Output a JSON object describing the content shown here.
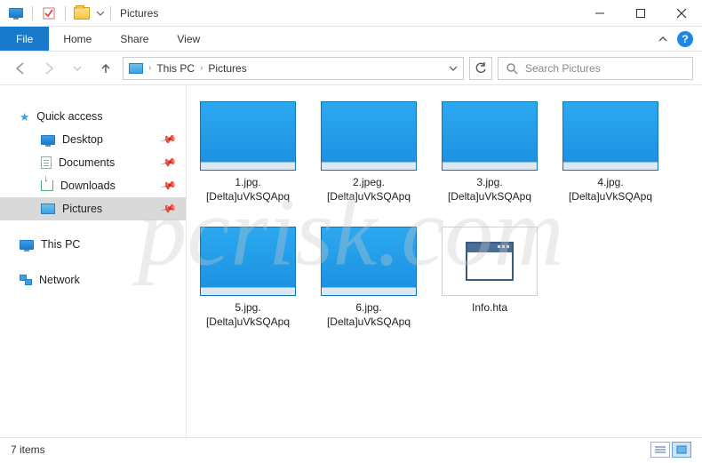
{
  "window": {
    "title": "Pictures"
  },
  "ribbon": {
    "file": "File",
    "tabs": [
      "Home",
      "Share",
      "View"
    ]
  },
  "breadcrumb": {
    "items": [
      "This PC",
      "Pictures"
    ]
  },
  "search": {
    "placeholder": "Search Pictures"
  },
  "sidebar": {
    "quickAccess": {
      "label": "Quick access",
      "items": [
        {
          "label": "Desktop",
          "icon": "monitor"
        },
        {
          "label": "Documents",
          "icon": "doc"
        },
        {
          "label": "Downloads",
          "icon": "dl"
        },
        {
          "label": "Pictures",
          "icon": "pic",
          "selected": true
        }
      ]
    },
    "thisPC": {
      "label": "This PC"
    },
    "network": {
      "label": "Network"
    }
  },
  "files": [
    {
      "name": "1.jpg.[Delta]uVkSQApq",
      "type": "desktop"
    },
    {
      "name": "2.jpeg.[Delta]uVkSQApq",
      "type": "desktop"
    },
    {
      "name": "3.jpg.[Delta]uVkSQApq",
      "type": "desktop"
    },
    {
      "name": "4.jpg.[Delta]uVkSQApq",
      "type": "desktop"
    },
    {
      "name": "5.jpg.[Delta]uVkSQApq",
      "type": "desktop"
    },
    {
      "name": "6.jpg.[Delta]uVkSQApq",
      "type": "desktop"
    },
    {
      "name": "Info.hta",
      "type": "hta"
    }
  ],
  "status": {
    "countText": "7 items"
  },
  "watermark": "pcrisk.com"
}
